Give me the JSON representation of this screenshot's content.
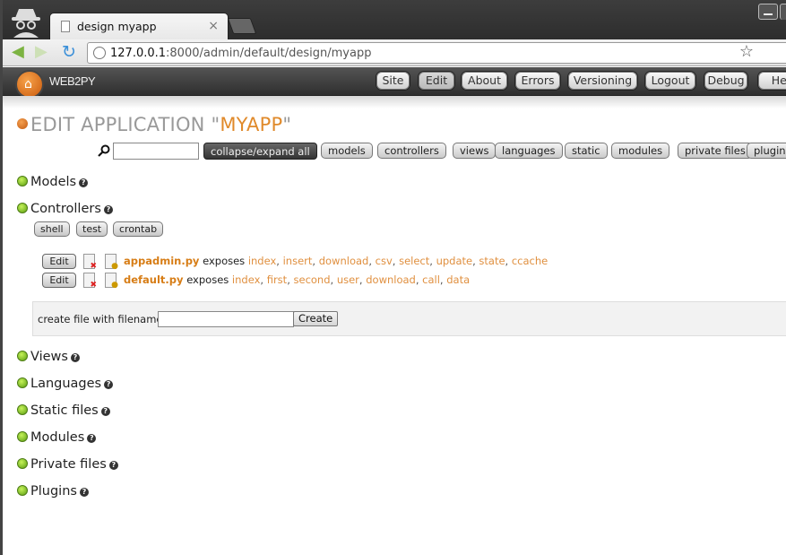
{
  "browser": {
    "tab_title": "design myapp",
    "tab_close": "×",
    "url_host": "127.0.0.1",
    "url_rest": ":8000/admin/default/design/myapp"
  },
  "web2py_nav": {
    "logo": "WEB2PY",
    "items": [
      "Site",
      "Edit",
      "About",
      "Errors",
      "Versioning",
      "Logout",
      "Debug",
      "Help"
    ],
    "active": "Edit"
  },
  "page": {
    "title_prefix": "EDIT APPLICATION \"",
    "app_name": "MYAPP",
    "title_suffix": "\""
  },
  "filter": {
    "collapse_label": "collapse/expand all",
    "jump_buttons": [
      "models",
      "controllers",
      "views",
      "languages",
      "static",
      "modules",
      "private files",
      "plugins"
    ]
  },
  "sections": {
    "models": "Models",
    "controllers": "Controllers",
    "views": "Views",
    "languages": "Languages",
    "static": "Static files",
    "modules": "Modules",
    "private": "Private files",
    "plugins": "Plugins"
  },
  "controller_tools": [
    "shell",
    "test",
    "crontab"
  ],
  "controllers": [
    {
      "edit_label": "Edit",
      "filename": "appadmin.py",
      "exposes_label": "exposes",
      "functions": [
        "index",
        "insert",
        "download",
        "csv",
        "select",
        "update",
        "state",
        "ccache"
      ]
    },
    {
      "edit_label": "Edit",
      "filename": "default.py",
      "exposes_label": "exposes",
      "functions": [
        "index",
        "first",
        "second",
        "user",
        "download",
        "call",
        "data"
      ]
    }
  ],
  "create_file": {
    "label": "create file with filename:",
    "button": "Create",
    "value": ""
  }
}
